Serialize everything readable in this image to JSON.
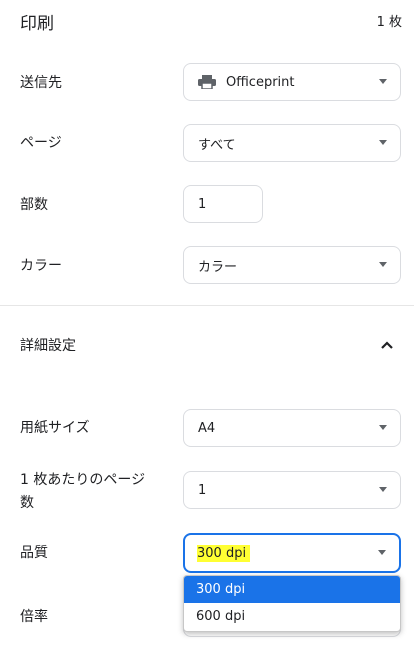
{
  "header": {
    "title": "印刷",
    "page_count": "1 枚"
  },
  "destination": {
    "label": "送信先",
    "value": "Officeprint",
    "icon": "printer-icon"
  },
  "pages": {
    "label": "ページ",
    "value": "すべて"
  },
  "copies": {
    "label": "部数",
    "value": "1"
  },
  "color": {
    "label": "カラー",
    "value": "カラー"
  },
  "advanced": {
    "label": "詳細設定",
    "toggle_icon": "chevron-up-icon"
  },
  "paper_size": {
    "label": "用紙サイズ",
    "value": "A4"
  },
  "pages_per_sheet": {
    "label_line1": "1 枚あたりのページ",
    "label_line2": "数",
    "value": "1"
  },
  "quality": {
    "label": "品質",
    "value": "300 dpi",
    "options": [
      "300 dpi",
      "600 dpi"
    ],
    "selected_index": 0,
    "highlight_color": "#ffff33",
    "focus_color": "#1a73e8"
  },
  "scale": {
    "label": "倍率"
  }
}
